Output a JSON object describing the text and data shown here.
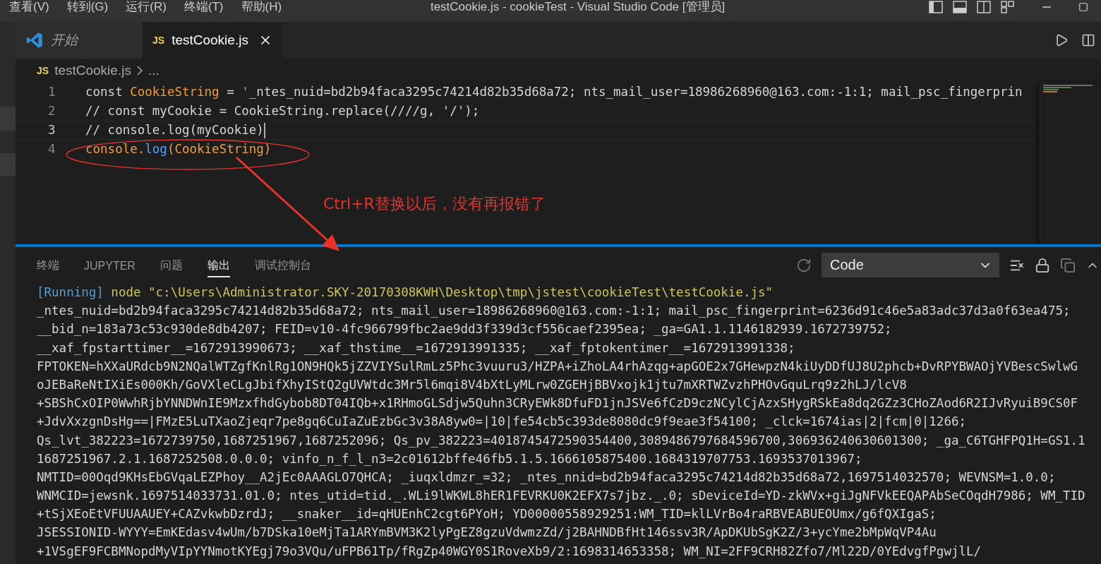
{
  "menu": [
    {
      "label": "查看(V)"
    },
    {
      "label": "转到(G)"
    },
    {
      "label": "运行(R)"
    },
    {
      "label": "终端(T)"
    },
    {
      "label": "帮助(H)"
    }
  ],
  "window_title": "testCookie.js - cookieTest - Visual Studio Code [管理员]",
  "editor_tabs": [
    {
      "label": "开始",
      "kind": "welcome",
      "selected": false
    },
    {
      "label": "testCookie.js",
      "kind": "file",
      "badge": "JS",
      "selected": true
    }
  ],
  "breadcrumb": {
    "badge": "JS",
    "file": "testCookie.js",
    "more": "..."
  },
  "code_lines": [
    {
      "number": "1",
      "current": false,
      "tokens": [
        {
          "text": "const ",
          "kind": "plain"
        },
        {
          "text": "CookieString",
          "kind": "variable"
        },
        {
          "text": " = ",
          "kind": "plain"
        },
        {
          "text": "'",
          "kind": "variable"
        },
        {
          "text": "_ntes_nuid=bd2b94faca3295c74214d82b35d68a72; nts_mail_user=18986268960@163.com:-1:1; mail_psc_fingerprin",
          "kind": "plain"
        }
      ]
    },
    {
      "number": "2",
      "current": false,
      "tokens": [
        {
          "text": "// const myCookie = CookieString.replace(////g, '/');",
          "kind": "plain"
        }
      ]
    },
    {
      "number": "3",
      "current": true,
      "tokens": [
        {
          "text": "// console.log(myCookie)",
          "kind": "plain"
        }
      ]
    },
    {
      "number": "4",
      "current": false,
      "tokens": [
        {
          "text": "console.",
          "kind": "variable"
        },
        {
          "text": "log",
          "kind": "method"
        },
        {
          "text": "(CookieString)",
          "kind": "variable"
        }
      ]
    }
  ],
  "annotation": {
    "text": "Ctrl+R替换以后，没有再报错了"
  },
  "panel": {
    "tabs": [
      {
        "label": "终端",
        "selected": false
      },
      {
        "label": "JUPYTER",
        "selected": false
      },
      {
        "label": "问题",
        "selected": false
      },
      {
        "label": "输出",
        "selected": true
      },
      {
        "label": "调试控制台",
        "selected": false
      }
    ],
    "output_channel": "Code",
    "lines": [
      [
        {
          "text": "[Running]",
          "kind": "tag"
        },
        {
          "text": " node \"c:\\Users\\Administrator.SKY-20170308KWH\\Desktop\\tmp\\jstest\\cookieTest\\testCookie.js\"",
          "kind": "path"
        }
      ],
      [
        {
          "text": "_ntes_nuid=bd2b94faca3295c74214d82b35d68a72; nts_mail_user=18986268960@163.com:-1:1; mail_psc_fingerprint=6236d91c46e5a83adc37d3a0f63ea475;",
          "kind": "plain"
        }
      ],
      [
        {
          "text": "__bid_n=183a73c53c930de8db4207; FEID=v10-4fc966799fbc2ae9dd3f339d3cf556caef2395ea; _ga=GA1.1.1146182939.1672739752;",
          "kind": "plain"
        }
      ],
      [
        {
          "text": "__xaf_fpstarttimer__=1672913990673; __xaf_thstime__=1672913991335; __xaf_fptokentimer__=1672913991338;",
          "kind": "plain"
        }
      ],
      [
        {
          "text": "FPTOKEN=hXXaURdcb9N2NQalWTZgfKnlRg1ON9HQk5jZZVIYSulRmLz5Phc3vuuru3/HZPA+iZhoLA4rhAzqg+apGOE2x7GHewpzN4kiUyDDfUJ8U2phcb+DvRPYBWAOjYVBescSwlwG",
          "kind": "plain"
        }
      ],
      [
        {
          "text": "oJEBaReNtIXiEs000Kh/GoVXleCLgJbifXhyIStQ2gUVWtdc3Mr5l6mqi8V4bXtLyMLrw0ZGEHjBBVxojk1jtu7mXRTWZvzhPHOvGquLrq9z2hLJ/lcV8",
          "kind": "plain"
        }
      ],
      [
        {
          "text": "+SBShCxOIP0WwhRjbYNNDWnIE9MzxfhdGybob8DT04IQb+x1RHmoGLSdjw5Quhn3CRyEWk8DfuFD1jnJSVe6fCzD9czNCylCjAzxSHygRSkEa8dq2GZz3CHoZAod6R2IJvRyuiB9CS0F",
          "kind": "plain"
        }
      ],
      [
        {
          "text": "+JdvXxzgnDsHg==|FMzE5LuTXaoZjeqr7pe8gq6CuIaZuEzbGc3v38A8yw0=|10|fe54cb5c393de8080dc9f9eae3f54100; _clck=1674ias|2|fcm|0|1266;",
          "kind": "plain"
        }
      ],
      [
        {
          "text": "Qs_lvt_382223=1672739750,1687251967,1687252096; Qs_pv_382223=4018745472590354400,3089486797684596700,306936240630601300; _ga_C6TGHFPQ1H=GS1.1",
          "kind": "plain"
        }
      ],
      [
        {
          "text": "1687251967.2.1.1687252508.0.0.0; vinfo_n_f_l_n3=2c01612bffe46fb5.1.5.1666105875400.1684319707753.1693537013967;",
          "kind": "plain"
        }
      ],
      [
        {
          "text": "NMTID=00Oqd9KHsEbGVqaLEZPhoy__A2jEc0AAAGLO7QHCA; _iuqxldmzr_=32; _ntes_nnid=bd2b94faca3295c74214d82b35d68a72,1697514032570; WEVNSM=1.0.0;",
          "kind": "plain"
        }
      ],
      [
        {
          "text": "WNMCID=jewsnk.1697514033731.01.0; ntes_utid=tid._.WLi9lWKWL8hER1FEVRKU0K2EFX7s7jbz._.0; sDeviceId=YD-zkWVx+giJgNFVkEEQAPAbSeCOqdH7986; WM_TID",
          "kind": "plain"
        }
      ],
      [
        {
          "text": "+tSjXEoEtVFUUAAUEY+CAZvkwbDzrdJ; __snaker__id=qHUEnhC2cgt6PYoH; YD00000558929251:WM_TID=klLVrBo4raRBVEABUEOUmx/g6fQXIgaS;",
          "kind": "plain"
        }
      ],
      [
        {
          "text": "JSESSIONID-WYYY=EmKEdasv4wUm/b7DSka10eMjTa1ARYmBVM3K2lyPgEZ8gzuVdwmzZd/j2BAHNDBfHt146ssv3R/ApDKUbSgK2Z/3+ycYme2bMpWqVP4Au",
          "kind": "plain"
        }
      ],
      [
        {
          "text": "+1VSgEF9FCBMNopdMyVIpYYNmotKYEgj79o3VQu/uFPB61Tp/fRgZp40WGY0S1RoveXb9/2:1698314653358; WM_NI=2FF9CRH82Zfo7/Ml22D/0YEdvgfPgwjlL/",
          "kind": "plain"
        }
      ]
    ]
  }
}
